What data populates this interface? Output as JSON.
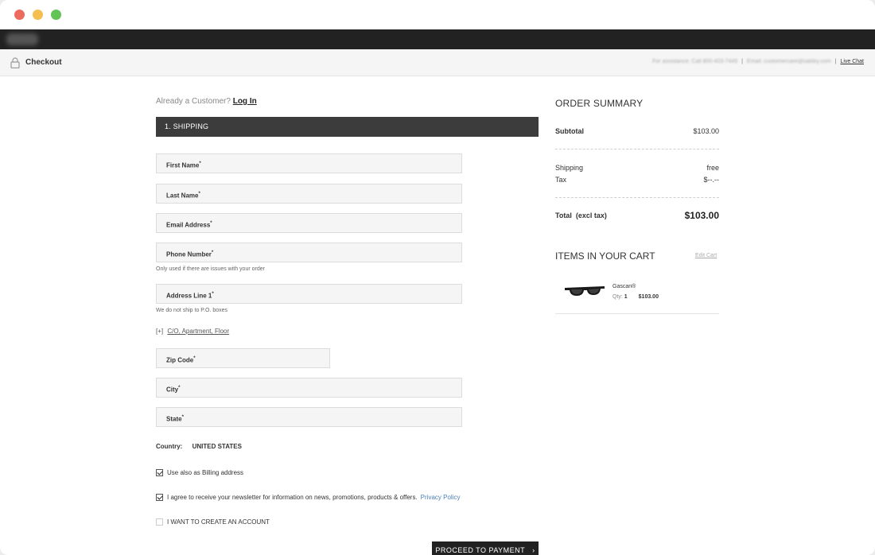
{
  "window": {
    "controls": [
      "close",
      "minimize",
      "maximize"
    ]
  },
  "topbar": {
    "logo": "blurred-logo"
  },
  "checkout_bar": {
    "title": "Checkout",
    "assistance": "For assistance: Call 800-403-7449",
    "email_label": "Email:",
    "email": "customercare@oakley.com",
    "live_chat": "Live Chat"
  },
  "login_prompt": {
    "text": "Already a Customer?",
    "link": "Log In"
  },
  "shipping": {
    "header": "1. SHIPPING",
    "fields": {
      "first_name": "First Name",
      "last_name": "Last Name",
      "email": "Email Address",
      "phone": "Phone Number",
      "address1": "Address Line 1",
      "zip": "Zip Code",
      "city": "City",
      "state": "State"
    },
    "required_mark": "*",
    "phone_hint": "Only used if there are issues with your order",
    "address_hint": "We do not ship to P.O. boxes",
    "co_plus": "[+]",
    "co_link": "C/O, Apartment, Floor",
    "country_label": "Country:",
    "country_value": "UNITED STATES",
    "billing_label": "Use also as Billing address",
    "billing_checked": true,
    "newsletter_label": "I agree to receive your newsletter for information on news, promotions, products & offers.",
    "newsletter_checked": true,
    "privacy_link": "Privacy Policy",
    "account_label": "I WANT TO CREATE AN ACCOUNT",
    "account_checked": false,
    "proceed": "PROCEED TO PAYMENT"
  },
  "summary": {
    "title": "ORDER SUMMARY",
    "subtotal_label": "Subtotal",
    "subtotal": "$103.00",
    "shipping_label": "Shipping",
    "shipping": "free",
    "tax_label": "Tax",
    "tax": "$--.--",
    "total_label": "Total  (excl tax)",
    "total": "$103.00"
  },
  "cart": {
    "title": "ITEMS IN YOUR CART",
    "edit": "Edit Cart",
    "items": [
      {
        "name": "Gascan®",
        "qty_label": "Qty:",
        "qty": "1",
        "price": "$103.00"
      }
    ]
  }
}
